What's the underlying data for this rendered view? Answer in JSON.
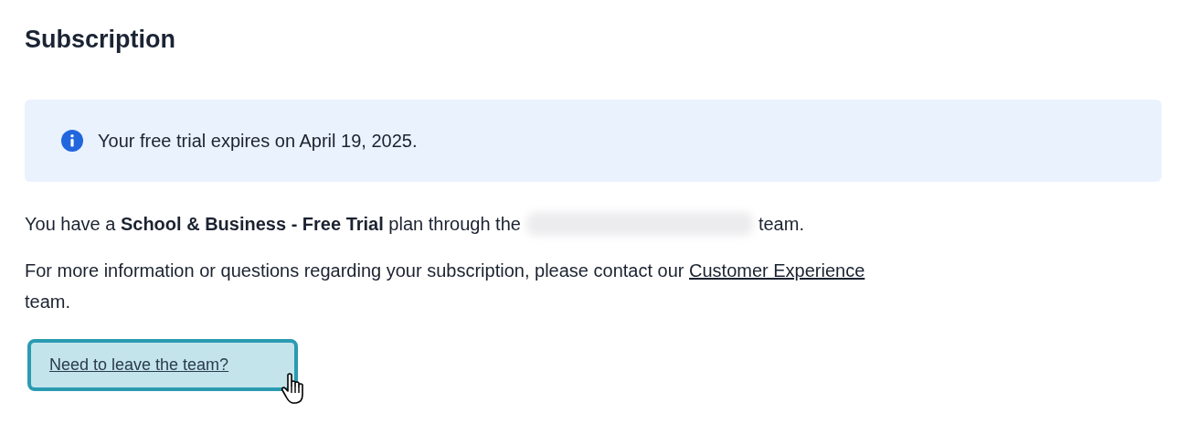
{
  "title": "Subscription",
  "notice": {
    "kind": "info",
    "text": "Your free trial expires on April 19, 2025."
  },
  "plan_line": {
    "before": "You have a **School & Business - Free Trial** plan through the",
    "team_name_blurred": true,
    "after": "team."
  },
  "contact_line": {
    "before": "For more information or questions regarding your subscription, please contact our",
    "link": "Customer Experience",
    "after": "team."
  },
  "leave_button": {
    "label": "Need to leave the team?",
    "focused": true
  }
}
